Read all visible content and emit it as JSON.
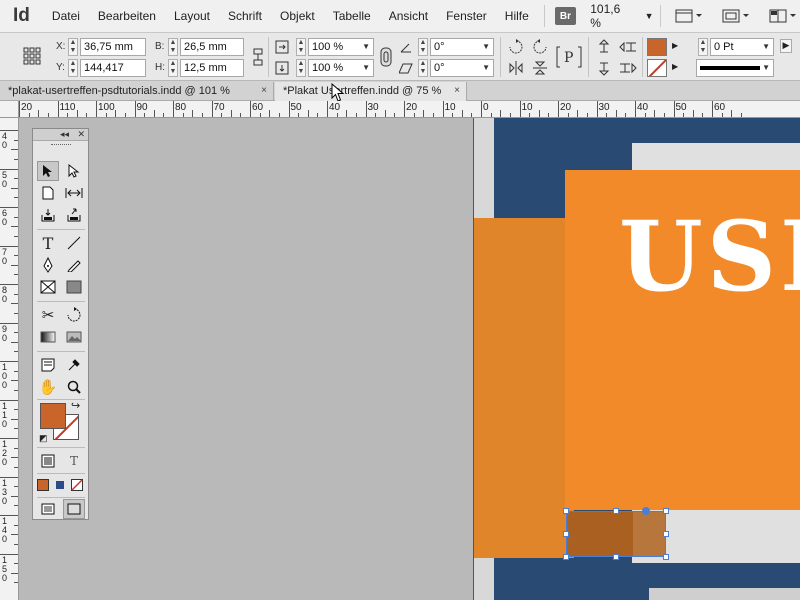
{
  "app": {
    "logo": "Id"
  },
  "menu": {
    "items": [
      "Datei",
      "Bearbeiten",
      "Layout",
      "Schrift",
      "Objekt",
      "Tabelle",
      "Ansicht",
      "Fenster",
      "Hilfe"
    ],
    "bridge_label": "Br",
    "zoom": "101,6 %"
  },
  "control": {
    "x_label": "X:",
    "x_value": "36,75 mm",
    "y_label": "Y:",
    "y_value": "144,417 mm",
    "w_label": "B:",
    "w_value": "26,5 mm",
    "h_label": "H:",
    "h_value": "12,5 mm",
    "scale_x": "100 %",
    "scale_y": "100 %",
    "rotate": "0°",
    "shear": "0°",
    "stroke_weight": "0 Pt",
    "fill_color": "#c9642a"
  },
  "tabs": [
    {
      "label": "*plakat-usertreffen-psdtutorials.indd @ 101 %",
      "close": "×"
    },
    {
      "label": "*Plakat Usertreffen.indd @ 75 %",
      "close": "×"
    }
  ],
  "ruler": {
    "h_labels": [
      "20",
      "110",
      "100",
      "90",
      "80",
      "70",
      "60",
      "50",
      "40",
      "30",
      "20",
      "10",
      "0",
      "10",
      "20",
      "30",
      "40",
      "50",
      "60"
    ],
    "v_labels": [
      "40",
      "50",
      "60",
      "70",
      "80",
      "90",
      "100",
      "110",
      "120",
      "130",
      "140",
      "150"
    ]
  },
  "document": {
    "headline": "USE"
  },
  "colors": {
    "orange": "#f28a2a",
    "navy": "#294a72",
    "selection": "#4a7fd8"
  }
}
